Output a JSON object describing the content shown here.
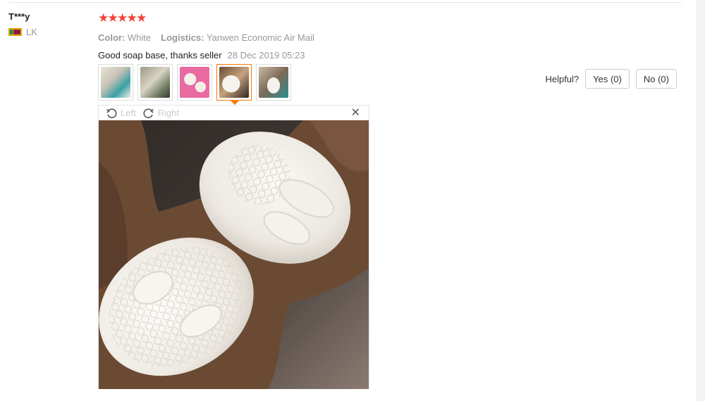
{
  "buyer": {
    "name": "T***y",
    "country": "LK"
  },
  "review": {
    "rating": 5,
    "stars": [
      "★",
      "★",
      "★",
      "★",
      "★"
    ],
    "color_label": "Color:",
    "color_value": "White",
    "logistics_label": "Logistics:",
    "logistics_value": "Yanwen Economic Air Mail",
    "comment": "Good soap base, thanks seller",
    "date": "28 Dec 2019 05:23"
  },
  "thumbnails": {
    "count": 5,
    "selected_index": 3
  },
  "helpful": {
    "label": "Helpful?",
    "yes_label": "Yes (0)",
    "no_label": "No (0)"
  },
  "viewer": {
    "rotate_left_label": "Left",
    "rotate_right_label": "Right",
    "close_icon": "close-icon"
  },
  "colors": {
    "star": "#f44336",
    "selected_thumb_border": "#ff7700",
    "muted_text": "#999999"
  }
}
